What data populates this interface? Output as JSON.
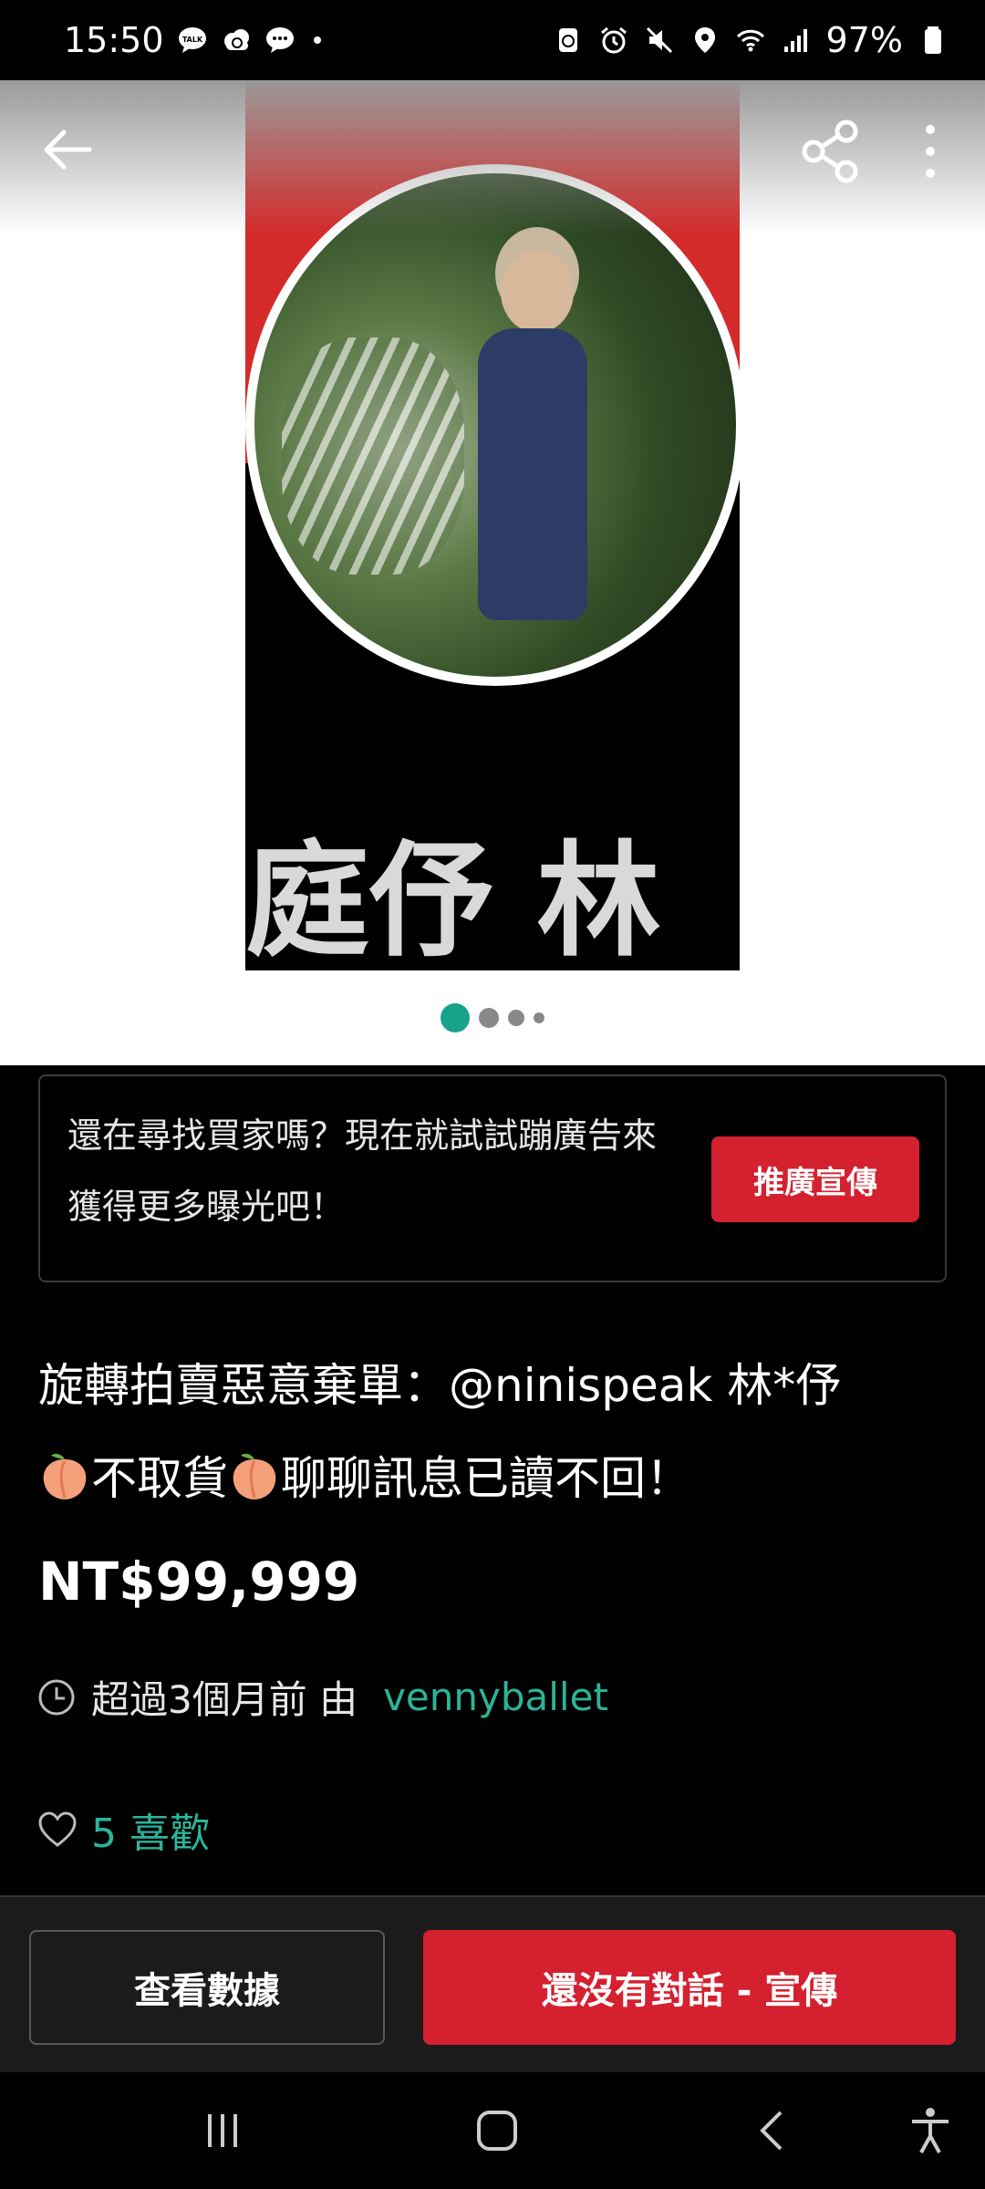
{
  "status_bar": {
    "time": "15:50",
    "battery": "97%",
    "icons_left": [
      "talk-icon",
      "cloud-icon",
      "chat-icon"
    ],
    "icons_right": [
      "recycle-icon",
      "alarm-icon",
      "mute-icon",
      "location-icon",
      "wifi-icon",
      "signal-icon",
      "battery-icon"
    ]
  },
  "hero": {
    "name_overlay": "庭伃 林",
    "page_count": 4,
    "active_page": 1
  },
  "promo": {
    "text": "還在尋找買家嗎？現在就試試蹦廣告來獲得更多曝光吧！",
    "button_label": "推廣宣傳"
  },
  "listing": {
    "title_part1": "旋轉拍賣惡意棄單：@ninispeak 林*伃",
    "title_part2": "不取貨",
    "title_part3": "聊聊訊息已讀不回！",
    "price": "NT$99,999",
    "posted_text": "超過3個月前 由",
    "seller": "vennyballet",
    "likes": "5 喜歡"
  },
  "actions": {
    "stats_label": "查看數據",
    "promote_label": "還沒有對話 - 宣傳"
  },
  "colors": {
    "accent_red": "#d5202f",
    "accent_teal": "#2bb49a"
  }
}
